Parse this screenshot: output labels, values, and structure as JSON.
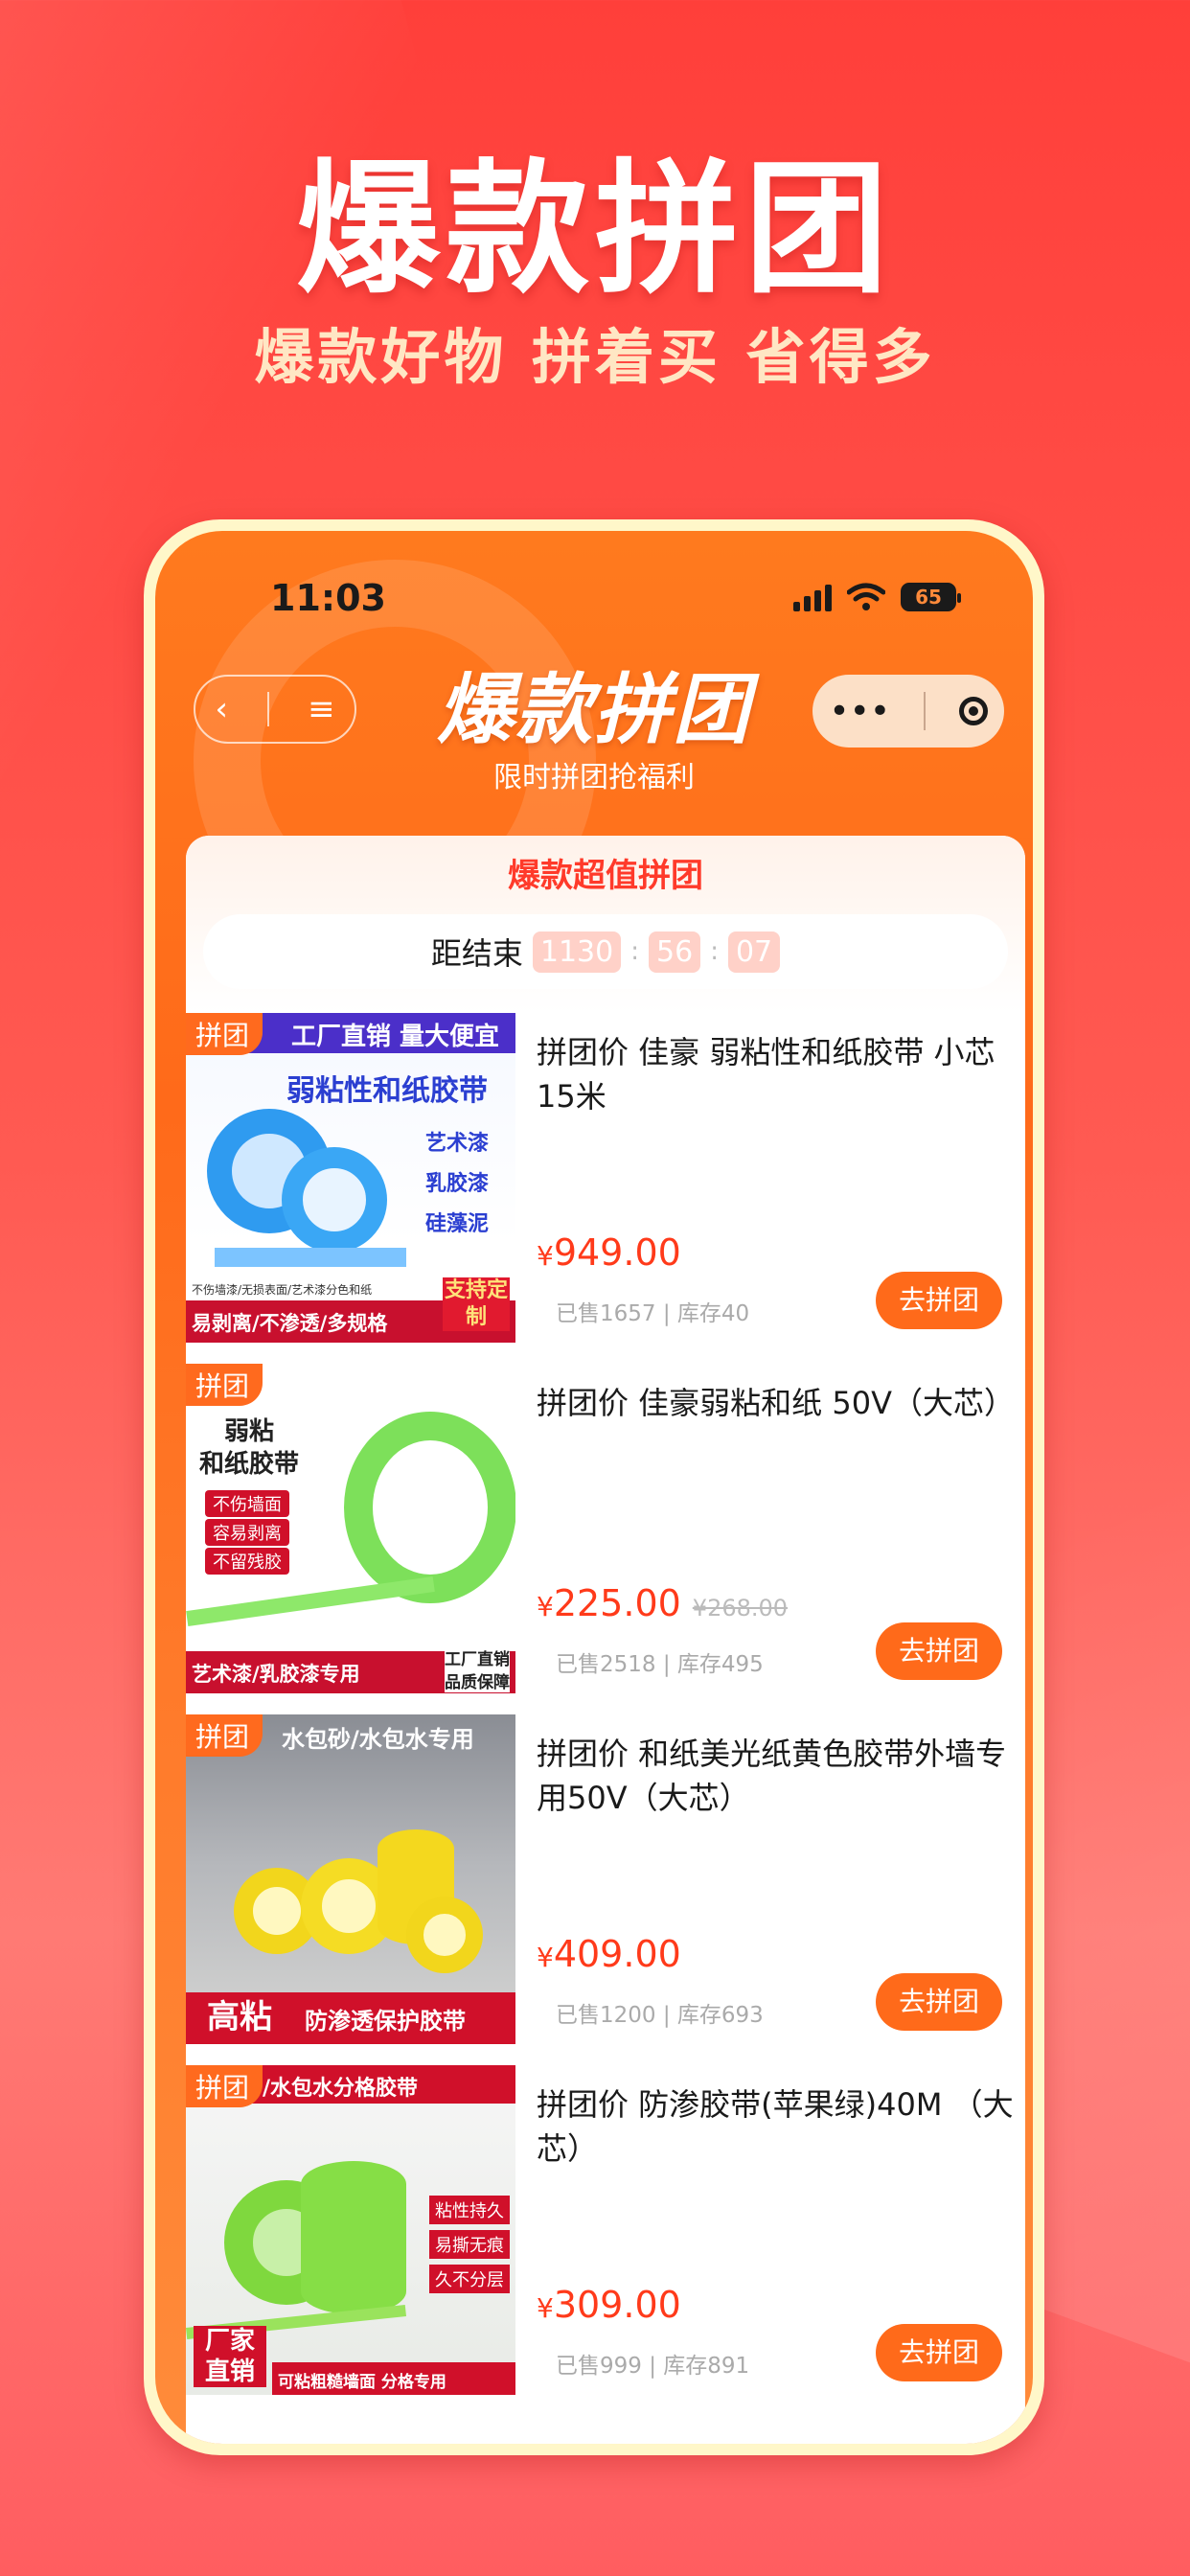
{
  "promo": {
    "title": "爆款拼团",
    "subtitle": "爆款好物 拼着买 省得多"
  },
  "status_bar": {
    "time": "11:03",
    "battery": "65"
  },
  "nav": {
    "back": "‹",
    "menu": "≡",
    "more": "•••"
  },
  "page": {
    "logo": "爆款拼团",
    "subtitle": "限时拼团抢福利"
  },
  "panel": {
    "title": "爆款超值拼团",
    "countdown": {
      "label": "距结束",
      "days": "1130",
      "hours": "56",
      "minutes": "07"
    }
  },
  "tag_label": "拼团",
  "join_label": "去拼团",
  "products": [
    {
      "name": "拼团价 佳豪 弱粘性和纸胶带 小芯15米",
      "yen": "¥",
      "price": "949.00",
      "orig": "",
      "stats": "已售1657 | 库存40",
      "image_text": {
        "banner": "工厂直销 量大便宜",
        "headline": "弱粘性和纸胶带",
        "points": [
          "艺术漆",
          "乳胶漆",
          "硅藻泥"
        ],
        "footer": "易剥离/不渗透/多规格",
        "badge": "支持定制",
        "note": "不伤墙漆/无损表面/艺术漆分色和纸"
      }
    },
    {
      "name": "拼团价 佳豪弱粘和纸 50V（大芯）",
      "yen": "¥",
      "price": "225.00",
      "orig": "¥268.00",
      "stats": "已售2518 | 库存495",
      "image_text": {
        "headline1": "弱粘",
        "headline2": "和纸胶带",
        "points": [
          "不伤墙面",
          "容易剥离",
          "不留残胶"
        ],
        "footer": "艺术漆/乳胶漆专用",
        "badge1": "工厂直销",
        "badge2": "品质保障"
      }
    },
    {
      "name": "拼团价 和纸美光纸黄色胶带外墙专用50V（大芯）",
      "yen": "¥",
      "price": "409.00",
      "orig": "",
      "stats": "已售1200 | 库存693",
      "image_text": {
        "banner": "水包砂/水包水专用",
        "badge": "高粘",
        "footer": "防渗透保护胶带"
      }
    },
    {
      "name": "拼团价 防渗胶带(苹果绿)40M （大芯）",
      "yen": "¥",
      "price": "309.00",
      "orig": "",
      "stats": "已售999 | 库存891",
      "image_text": {
        "banner": "/水包水分格胶带",
        "points": [
          "粘性持久",
          "易撕无痕",
          "久不分层"
        ],
        "badge": "厂家直销",
        "footer": "可粘粗糙墙面 分格专用"
      }
    }
  ]
}
